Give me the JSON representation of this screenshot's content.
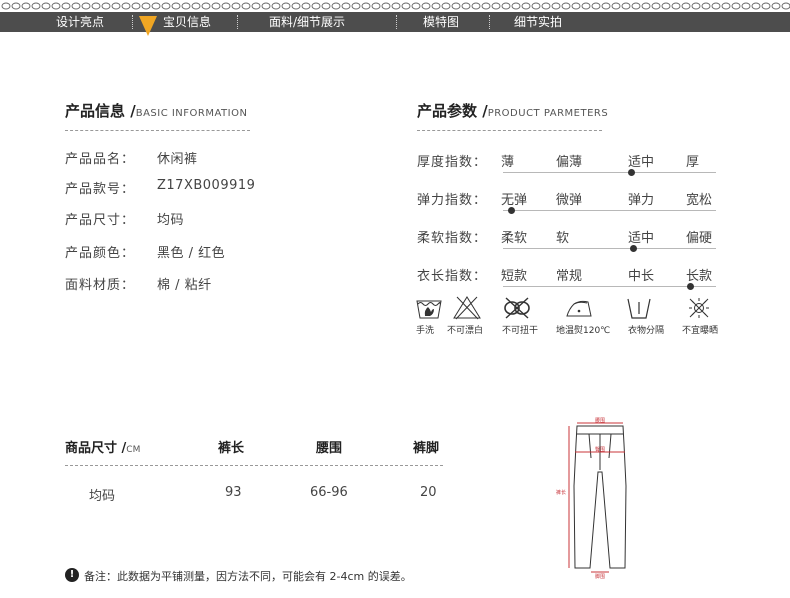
{
  "nav": {
    "items": [
      "设计亮点",
      "宝贝信息",
      "面料/细节展示",
      "模特图",
      "细节实拍"
    ],
    "active_index": 1
  },
  "product_info": {
    "title": "产品信息 /",
    "title_en": "BASIC INFORMATION",
    "rows": [
      {
        "label": "产品品名：",
        "value": "休闲裤"
      },
      {
        "label": "产品款号：",
        "value": "Z17XB009919"
      },
      {
        "label": "产品尺寸：",
        "value": "均码"
      },
      {
        "label": "产品颜色：",
        "value": "黑色 / 红色"
      },
      {
        "label": "面料材质：",
        "value": "棉 / 粘纤"
      }
    ]
  },
  "product_params": {
    "title": "产品参数 /",
    "title_en": "PRODUCT PARMETERS",
    "rows": [
      {
        "label": "厚度指数：",
        "options": [
          "薄",
          "偏薄",
          "适中",
          "厚"
        ],
        "selected": 0.62
      },
      {
        "label": "弹力指数：",
        "options": [
          "无弹",
          "微弹",
          "弹力",
          "宽松"
        ],
        "selected": 0.0
      },
      {
        "label": "柔软指数：",
        "options": [
          "柔软",
          "软",
          "适中",
          "偏硬"
        ],
        "selected": 0.63
      },
      {
        "label": "衣长指数：",
        "options": [
          "短款",
          "常规",
          "中长",
          "长款"
        ],
        "selected": 0.93
      }
    ]
  },
  "care": {
    "items": [
      {
        "icon": "hand-wash-icon",
        "label": "手洗"
      },
      {
        "icon": "no-bleach-icon",
        "label": "不可漂白"
      },
      {
        "icon": "no-wring-icon",
        "label": "不可扭干"
      },
      {
        "icon": "low-iron-icon",
        "label": "地温熨120℃"
      },
      {
        "icon": "separate-wash-icon",
        "label": "衣物分隔"
      },
      {
        "icon": "no-sun-icon",
        "label": "不宜曝晒"
      }
    ]
  },
  "size_table": {
    "header": {
      "title": "商品尺寸 /",
      "unit": "CM",
      "cols": [
        "裤长",
        "腰围",
        "裤脚"
      ]
    },
    "rows": [
      {
        "size": "均码",
        "values": [
          "93",
          "66-96",
          "20"
        ]
      }
    ]
  },
  "diagram": {
    "labels": {
      "waist": "腰围",
      "hip": "臀围",
      "length": "裤长",
      "hem": "脚围"
    }
  },
  "note": {
    "icon": "!",
    "text": "备注：此数据为平铺测量，因方法不同，可能会有 2-4cm 的误差。"
  },
  "colors": {
    "nav_bg": "#4d4d4d",
    "arrow": "#f0a623",
    "measure": "#c8343a"
  }
}
